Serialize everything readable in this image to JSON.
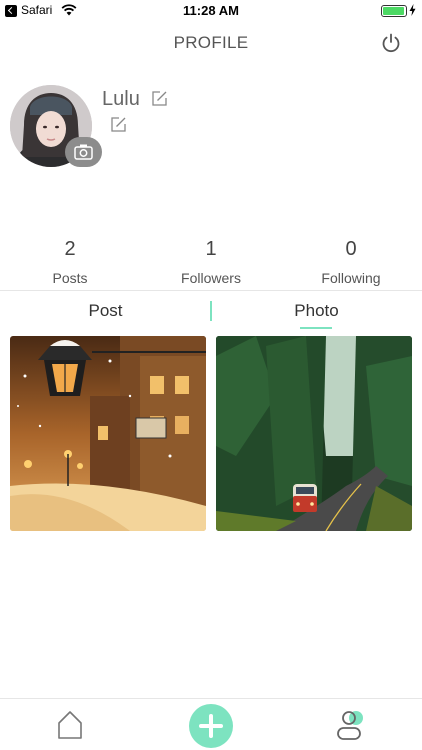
{
  "status_bar": {
    "app": "Safari",
    "time": "11:28 AM",
    "battery_level": 0.95,
    "battery_color": "#4cd964"
  },
  "header": {
    "title": "PROFILE",
    "power_icon": "power-icon"
  },
  "profile": {
    "username": "Lulu",
    "edit_icon": "edit-icon",
    "camera_icon": "camera-icon"
  },
  "stats": [
    {
      "value": "2",
      "label": "Posts"
    },
    {
      "value": "1",
      "label": "Followers"
    },
    {
      "value": "0",
      "label": "Following"
    }
  ],
  "tabs": [
    {
      "label": "Post",
      "selected": false
    },
    {
      "label": "Photo",
      "selected": true
    }
  ],
  "accent_color": "#7de3c0",
  "photos": [
    {
      "subject": "snowy-street-at-night"
    },
    {
      "subject": "van-on-forest-road"
    }
  ],
  "tab_bar": [
    {
      "icon": "home-icon"
    },
    {
      "icon": "add-icon"
    },
    {
      "icon": "profile-icon"
    }
  ]
}
